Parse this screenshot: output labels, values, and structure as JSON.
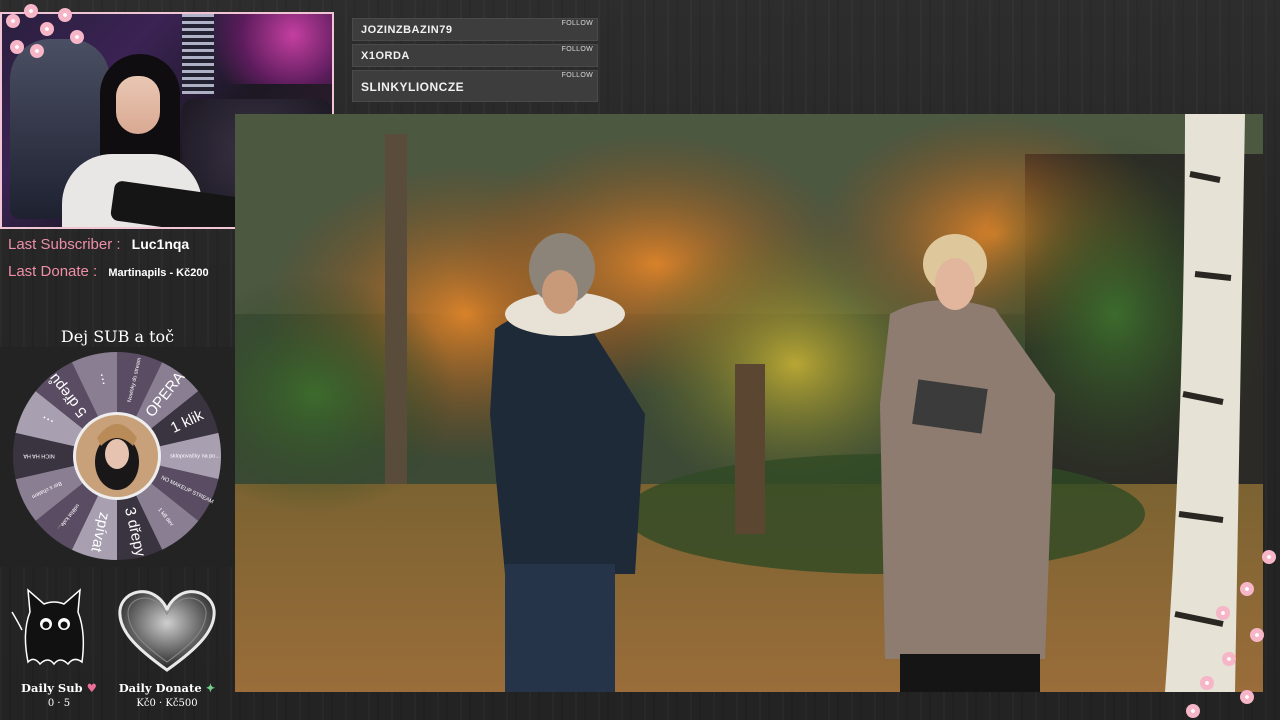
{
  "followers": [
    {
      "name": "JOZINZBAZIN79",
      "tag": "FOLLOW"
    },
    {
      "name": "X1ORDA",
      "tag": "FOLLOW"
    },
    {
      "name": "SLINKYLIONCZE",
      "tag": "FOLLOW"
    }
  ],
  "stats": {
    "last_subscriber_label": "Last Subscriber :",
    "last_subscriber_value": "Luc1nqa",
    "last_donate_label": "Last Donate :",
    "last_donate_value": "Martinapils - Kč200"
  },
  "wheel": {
    "title": "Dej SUB a toč",
    "segments": [
      "Novinky do stream",
      "OPERA",
      "1 klik",
      "sklopovačky na po...",
      "NO MAKEUP STREAM",
      "1 kill dev",
      "3 dřepy",
      "zpívat",
      "udělat kafe...",
      "Ber s chatem",
      "NICH HA HA",
      "...",
      "5 dřepů",
      "..."
    ]
  },
  "daily": {
    "sub_label": "Daily Sub",
    "sub_value": "0 · 5",
    "donate_label": "Daily Donate",
    "donate_value": "Kč0 · Kč500"
  },
  "colors": {
    "accent_pink": "#ee8fa8",
    "panel": "#3d3d3d",
    "background": "#262626"
  }
}
